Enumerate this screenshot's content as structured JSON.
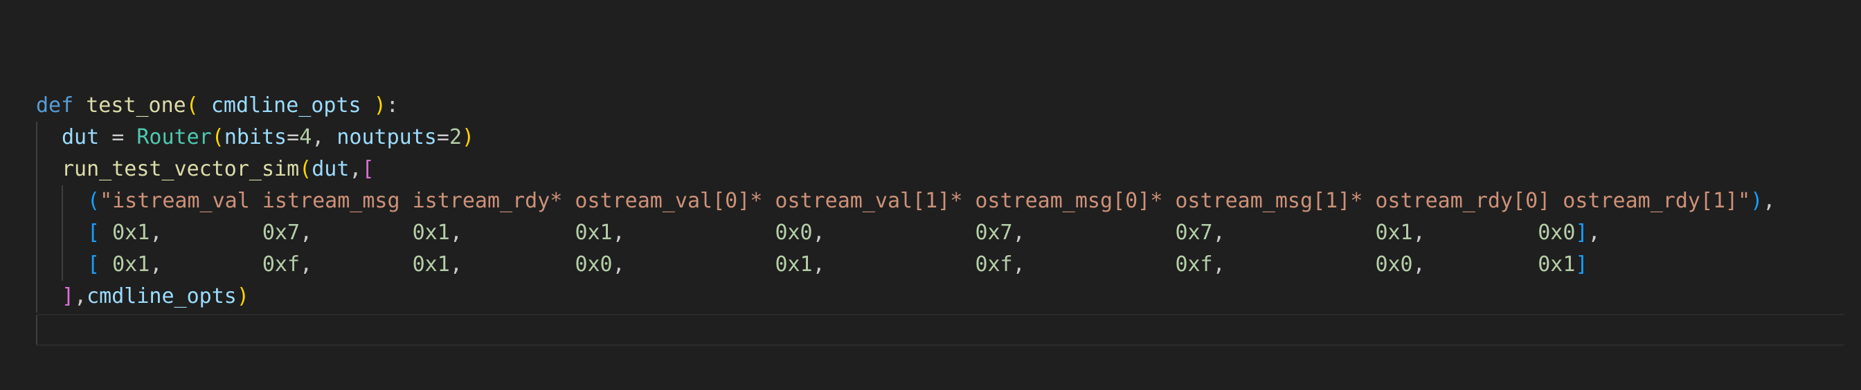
{
  "colors": {
    "background": "#1f1f1f",
    "keyword": "#569cd6",
    "function": "#dcdcaa",
    "class": "#4ec9b0",
    "variable": "#9cdcfe",
    "number": "#b5cea8",
    "string": "#ce9178",
    "bracket_gold": "#ffd700",
    "bracket_purple": "#da70d6",
    "bracket_blue": "#179fff",
    "text": "#cccccc"
  },
  "lines": [
    {
      "indent": 0,
      "tokens": [
        {
          "t": "def",
          "c": "keyword"
        },
        {
          "t": " ",
          "c": "text"
        },
        {
          "t": "test_one",
          "c": "function"
        },
        {
          "t": "(",
          "c": "bracket_gold"
        },
        {
          "t": " ",
          "c": "text"
        },
        {
          "t": "cmdline_opts",
          "c": "variable"
        },
        {
          "t": " ",
          "c": "text"
        },
        {
          "t": ")",
          "c": "bracket_gold"
        },
        {
          "t": ":",
          "c": "text"
        }
      ]
    },
    {
      "indent": 1,
      "tokens": [
        {
          "t": "dut",
          "c": "variable"
        },
        {
          "t": " = ",
          "c": "text"
        },
        {
          "t": "Router",
          "c": "class"
        },
        {
          "t": "(",
          "c": "bracket_gold"
        },
        {
          "t": "nbits",
          "c": "variable"
        },
        {
          "t": "=",
          "c": "text"
        },
        {
          "t": "4",
          "c": "number"
        },
        {
          "t": ", ",
          "c": "text"
        },
        {
          "t": "noutputs",
          "c": "variable"
        },
        {
          "t": "=",
          "c": "text"
        },
        {
          "t": "2",
          "c": "number"
        },
        {
          "t": ")",
          "c": "bracket_gold"
        }
      ]
    },
    {
      "indent": 1,
      "tokens": [
        {
          "t": "run_test_vector_sim",
          "c": "function"
        },
        {
          "t": "(",
          "c": "bracket_gold"
        },
        {
          "t": "dut",
          "c": "variable"
        },
        {
          "t": ",",
          "c": "text"
        },
        {
          "t": "[",
          "c": "bracket_purple"
        }
      ]
    },
    {
      "indent": 2,
      "tokens": [
        {
          "t": "(",
          "c": "bracket_blue"
        },
        {
          "t": "\"istream_val istream_msg istream_rdy* ostream_val[0]* ostream_val[1]* ostream_msg[0]* ostream_msg[1]* ostream_rdy[0] ostream_rdy[1]\"",
          "c": "string"
        },
        {
          "t": ")",
          "c": "bracket_blue"
        },
        {
          "t": ",",
          "c": "text"
        }
      ]
    },
    {
      "indent": 2,
      "tokens": [
        {
          "t": "[",
          "c": "bracket_blue"
        },
        {
          "t": " ",
          "c": "text"
        },
        {
          "t": "0x1",
          "c": "number"
        },
        {
          "t": ",        ",
          "c": "text"
        },
        {
          "t": "0x7",
          "c": "number"
        },
        {
          "t": ",        ",
          "c": "text"
        },
        {
          "t": "0x1",
          "c": "number"
        },
        {
          "t": ",         ",
          "c": "text"
        },
        {
          "t": "0x1",
          "c": "number"
        },
        {
          "t": ",            ",
          "c": "text"
        },
        {
          "t": "0x0",
          "c": "number"
        },
        {
          "t": ",            ",
          "c": "text"
        },
        {
          "t": "0x7",
          "c": "number"
        },
        {
          "t": ",            ",
          "c": "text"
        },
        {
          "t": "0x7",
          "c": "number"
        },
        {
          "t": ",            ",
          "c": "text"
        },
        {
          "t": "0x1",
          "c": "number"
        },
        {
          "t": ",         ",
          "c": "text"
        },
        {
          "t": "0x0",
          "c": "number"
        },
        {
          "t": "]",
          "c": "bracket_blue"
        },
        {
          "t": ",",
          "c": "text"
        }
      ]
    },
    {
      "indent": 2,
      "tokens": [
        {
          "t": "[",
          "c": "bracket_blue"
        },
        {
          "t": " ",
          "c": "text"
        },
        {
          "t": "0x1",
          "c": "number"
        },
        {
          "t": ",        ",
          "c": "text"
        },
        {
          "t": "0xf",
          "c": "number"
        },
        {
          "t": ",        ",
          "c": "text"
        },
        {
          "t": "0x1",
          "c": "number"
        },
        {
          "t": ",         ",
          "c": "text"
        },
        {
          "t": "0x0",
          "c": "number"
        },
        {
          "t": ",            ",
          "c": "text"
        },
        {
          "t": "0x1",
          "c": "number"
        },
        {
          "t": ",            ",
          "c": "text"
        },
        {
          "t": "0xf",
          "c": "number"
        },
        {
          "t": ",            ",
          "c": "text"
        },
        {
          "t": "0xf",
          "c": "number"
        },
        {
          "t": ",            ",
          "c": "text"
        },
        {
          "t": "0x0",
          "c": "number"
        },
        {
          "t": ",         ",
          "c": "text"
        },
        {
          "t": "0x1",
          "c": "number"
        },
        {
          "t": "]",
          "c": "bracket_blue"
        }
      ]
    },
    {
      "indent": 1,
      "tokens": [
        {
          "t": "]",
          "c": "bracket_purple"
        },
        {
          "t": ",",
          "c": "text"
        },
        {
          "t": "cmdline_opts",
          "c": "variable"
        },
        {
          "t": ")",
          "c": "bracket_gold"
        }
      ]
    }
  ]
}
